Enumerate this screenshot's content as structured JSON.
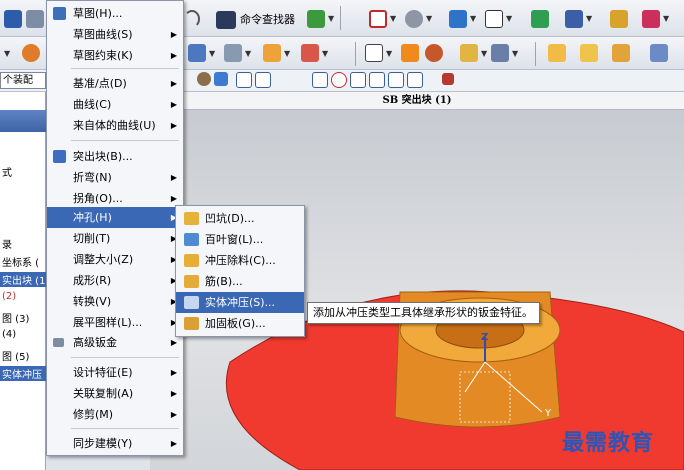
{
  "toolbar": {
    "command_finder_label": "命令查找器"
  },
  "left_panel": {
    "assembly_field": "个装配",
    "rows": [
      "式",
      "录",
      "坐标系 (",
      "实出块 (1",
      "(2)",
      "图 (3)",
      "(4)",
      "图 (5)",
      "实体冲压"
    ]
  },
  "viewport": {
    "title": "SB 突出块 (1)",
    "axis_z": "Z",
    "axis_y": "Y",
    "background_top": "#c5c9cf",
    "part_color": "#e8932a",
    "sheet_color": "#f03a30"
  },
  "main_menu": {
    "items": [
      {
        "label": "草图(H)...",
        "submenu": false
      },
      {
        "label": "草图曲线(S)",
        "submenu": true
      },
      {
        "label": "草图约束(K)",
        "submenu": true
      },
      {
        "label": "基准/点(D)",
        "submenu": true
      },
      {
        "label": "曲线(C)",
        "submenu": true
      },
      {
        "label": "来自体的曲线(U)",
        "submenu": true
      },
      {
        "label": "突出块(B)...",
        "submenu": false
      },
      {
        "label": "折弯(N)",
        "submenu": true
      },
      {
        "label": "拐角(O)...",
        "submenu": true
      },
      {
        "label": "冲孔(H)",
        "submenu": true
      },
      {
        "label": "切削(T)",
        "submenu": true
      },
      {
        "label": "调整大小(Z)",
        "submenu": true
      },
      {
        "label": "成形(R)",
        "submenu": true
      },
      {
        "label": "转换(V)",
        "submenu": true
      },
      {
        "label": "展平图样(L)...",
        "submenu": true
      },
      {
        "label": "高级钣金",
        "submenu": true
      },
      {
        "label": "设计特征(E)",
        "submenu": true
      },
      {
        "label": "关联复制(A)",
        "submenu": true
      },
      {
        "label": "修剪(M)",
        "submenu": true
      },
      {
        "label": "同步建模(Y)",
        "submenu": true
      }
    ]
  },
  "submenu": {
    "items": [
      {
        "label": "凹坑(D)...",
        "icon": "dimple-icon"
      },
      {
        "label": "百叶窗(L)...",
        "icon": "louver-icon"
      },
      {
        "label": "冲压除料(C)...",
        "icon": "drawn-cutout-icon"
      },
      {
        "label": "筋(B)...",
        "icon": "bead-icon"
      },
      {
        "label": "实体冲压(S)...",
        "icon": "solid-punch-icon"
      },
      {
        "label": "加固板(G)...",
        "icon": "gusset-icon"
      }
    ]
  },
  "tooltip": {
    "text": "添加从冲压类型工具体继承形状的钣金特征。"
  },
  "watermark": "最需教育",
  "colors": {
    "menu_highlight": "#3a68b4"
  }
}
